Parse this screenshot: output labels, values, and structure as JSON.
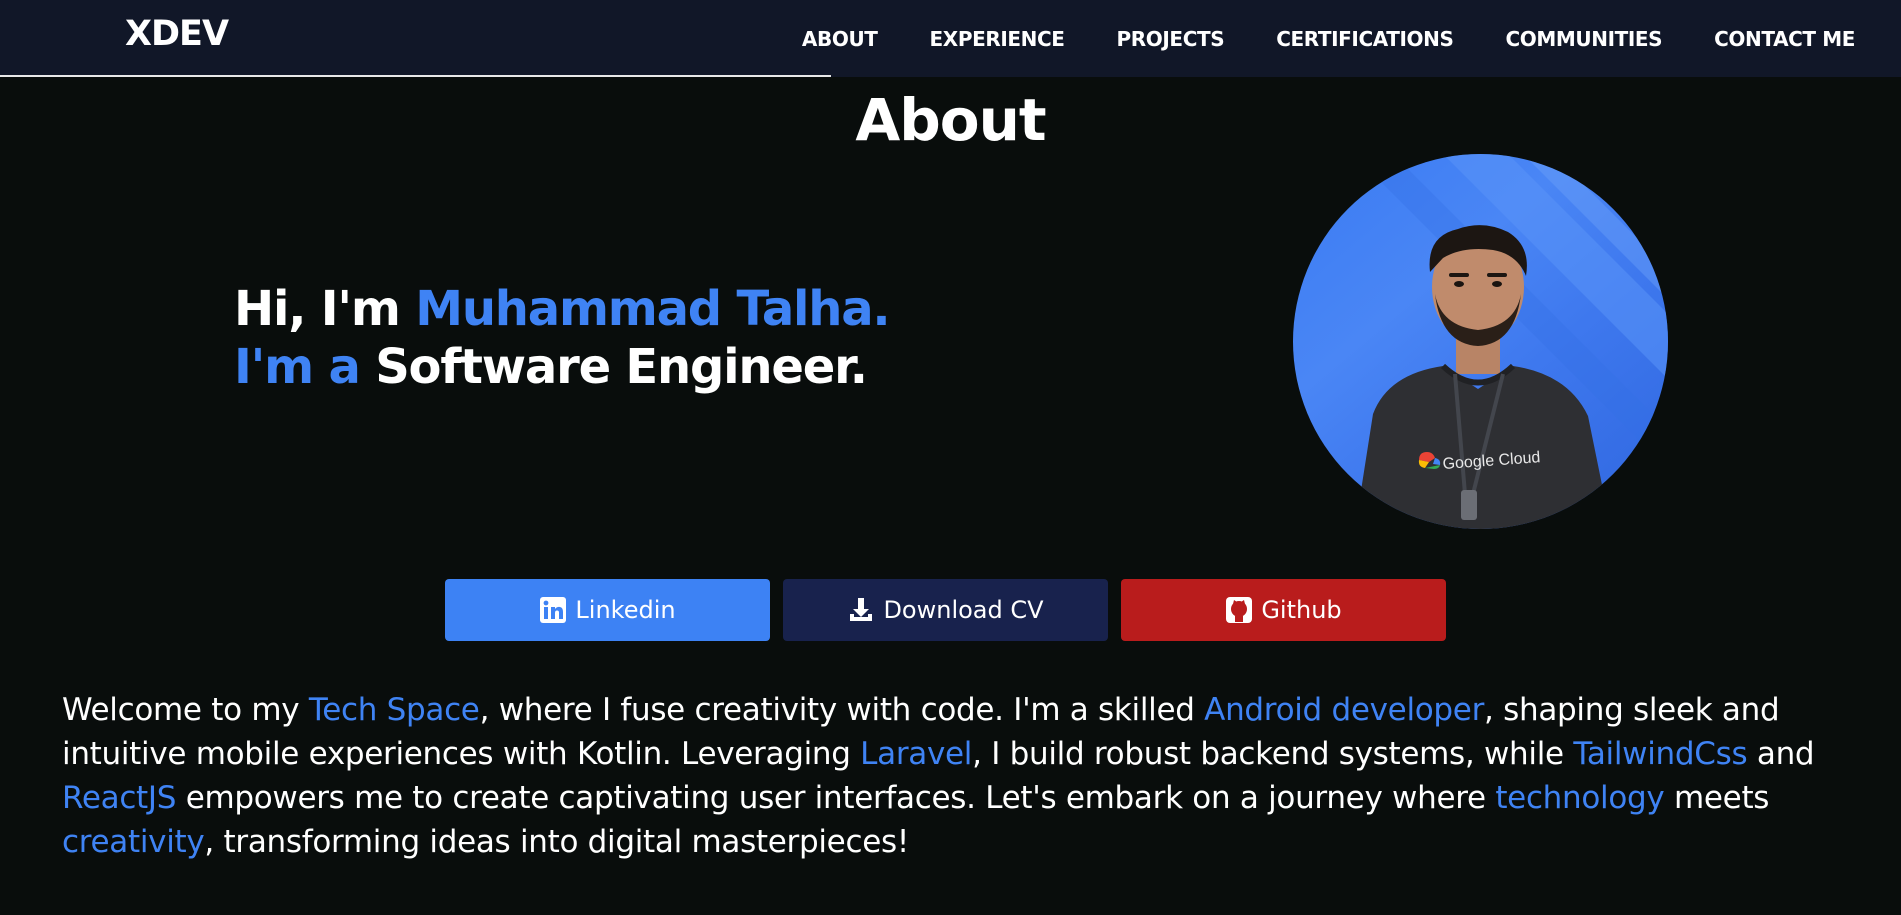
{
  "brand": {
    "name": "XDEV"
  },
  "nav": {
    "items": [
      "ABOUT",
      "EXPERIENCE",
      "PROJECTS",
      "CERTIFICATIONS",
      "COMMUNITIES",
      "CONTACT ME"
    ]
  },
  "section": {
    "title": "About"
  },
  "hero": {
    "greeting": "Hi, I'm ",
    "name": "Muhammad Talha.",
    "role_prefix": "I'm a ",
    "role": "Software Engineer."
  },
  "profile": {
    "shirt_text": "Google Cloud"
  },
  "buttons": {
    "linkedin": {
      "label": "Linkedin",
      "icon": "linkedin-icon"
    },
    "cv": {
      "label": "Download CV",
      "icon": "download-icon"
    },
    "github": {
      "label": "Github",
      "icon": "github-icon"
    }
  },
  "bio": {
    "segments": [
      {
        "text": "Welcome to my ",
        "highlight": false
      },
      {
        "text": "Tech Space",
        "highlight": true
      },
      {
        "text": ", where I fuse creativity with code. I'm a skilled ",
        "highlight": false
      },
      {
        "text": "Android developer",
        "highlight": true
      },
      {
        "text": ", shaping sleek and intuitive mobile experiences with Kotlin. Leveraging ",
        "highlight": false
      },
      {
        "text": "Laravel",
        "highlight": true
      },
      {
        "text": ", I build robust backend systems, while ",
        "highlight": false
      },
      {
        "text": "TailwindCss",
        "highlight": true
      },
      {
        "text": " and ",
        "highlight": false
      },
      {
        "text": "ReactJS",
        "highlight": true
      },
      {
        "text": " empowers me to create captivating user interfaces. Let's embark on a journey where ",
        "highlight": false
      },
      {
        "text": "technology",
        "highlight": true
      },
      {
        "text": " meets ",
        "highlight": false
      },
      {
        "text": "creativity",
        "highlight": true
      },
      {
        "text": ", transforming ideas into digital masterpieces!",
        "highlight": false
      }
    ]
  },
  "colors": {
    "page_bg": "#090d0c",
    "nav_bg": "#111728",
    "accent_blue": "#3f83f4",
    "linkedin_bg": "#3d82f4",
    "cv_bg": "#18224d",
    "github_bg": "#b91c1c"
  }
}
